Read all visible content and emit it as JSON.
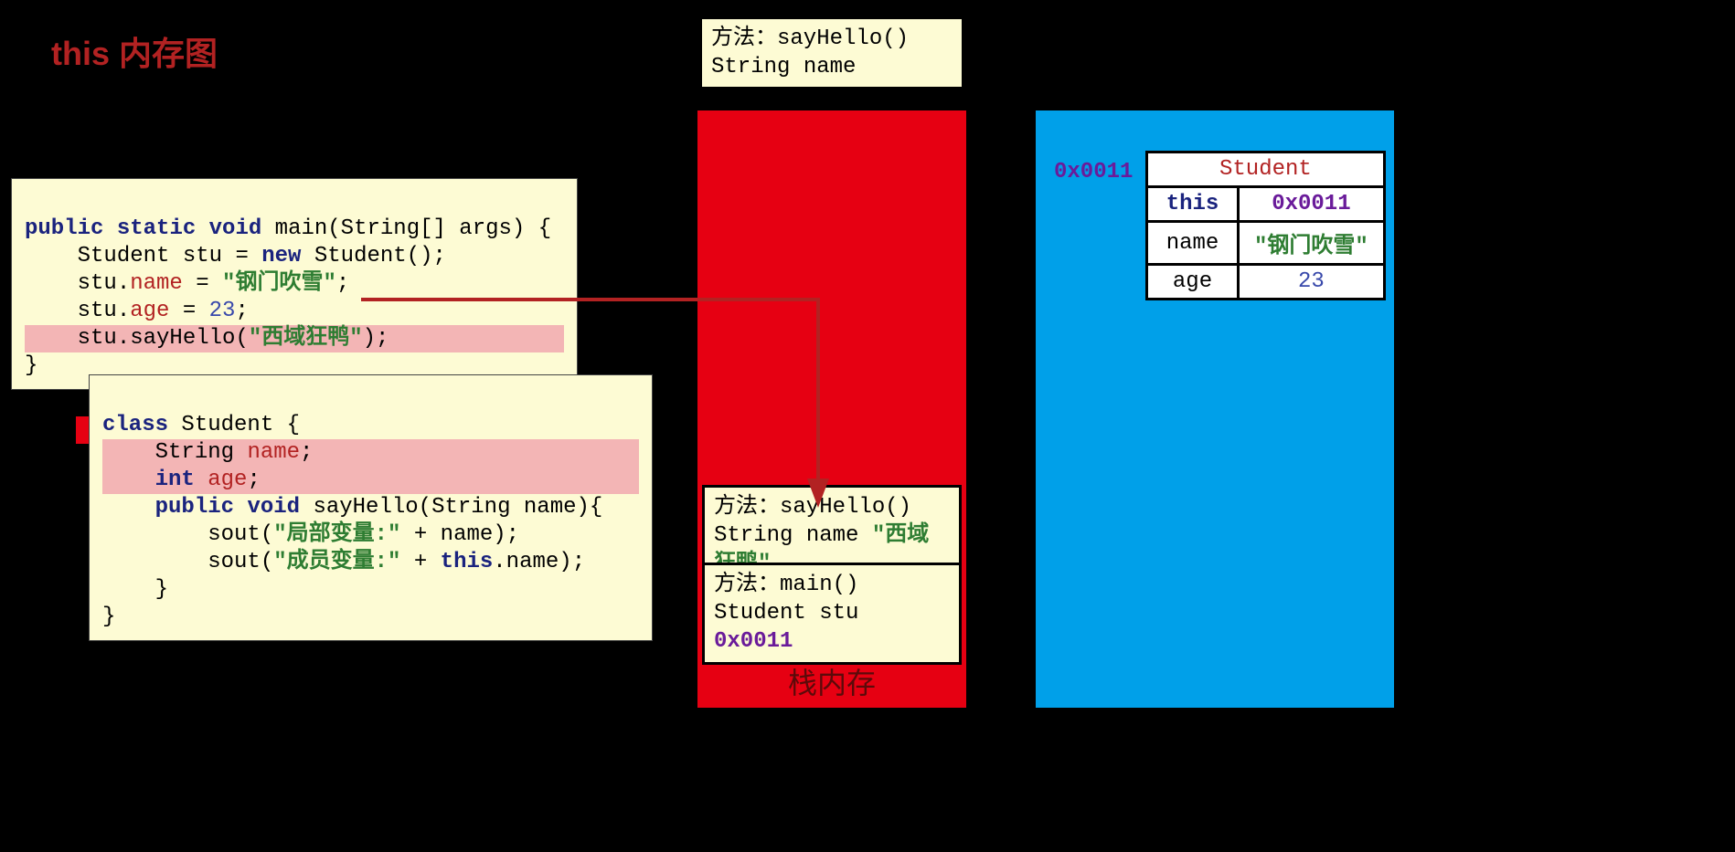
{
  "title": "this 内存图",
  "code_main": {
    "line1_a": "public",
    "line1_b": "static",
    "line1_c": "void",
    "line1_d": " main(String[] args) {",
    "line2_a": "    Student stu = ",
    "line2_b": "new",
    "line2_c": " Student();",
    "line3_a": "    stu.",
    "line3_b": "name",
    "line3_c": " = ",
    "line3_d": "\"钢门吹雪\"",
    "line3_e": ";",
    "line4_a": "    stu.",
    "line4_b": "age",
    "line4_c": " = ",
    "line4_d": "23",
    "line4_e": ";",
    "line5_a": "    stu.sayHello(",
    "line5_b": "\"西域狂鸭\"",
    "line5_c": ");",
    "line6": "}"
  },
  "code_class": {
    "line1_a": "class",
    "line1_b": " Student {",
    "line2_a": "    String ",
    "line2_b": "name",
    "line2_c": ";",
    "line3_a": "    ",
    "line3_b": "int",
    "line3_c": " ",
    "line3_d": "age",
    "line3_e": ";",
    "line4_a": "    ",
    "line4_b": "public",
    "line4_c": " ",
    "line4_d": "void",
    "line4_e": " sayHello(String name){",
    "line5_a": "        sout(",
    "line5_b": "\"局部变量:\"",
    "line5_c": " + name);",
    "line6_a": "        sout(",
    "line6_b": "\"成员变量:\"",
    "line6_c": " + ",
    "line6_d": "this",
    "line6_e": ".name);",
    "line7": "    }",
    "line8": "}"
  },
  "overflow_frame": {
    "line1_a": "方法：",
    "line1_b": "sayHello()",
    "line2": "String name"
  },
  "stack": {
    "label": "栈内存",
    "frame_sayhello": {
      "line1_a": "方法：",
      "line1_b": "sayHello()",
      "line2_a": "String name ",
      "line2_b": "\"西域狂鸭\""
    },
    "frame_main": {
      "line1_a": "方法：",
      "line1_b": "main()",
      "line2_a": "Student stu  ",
      "line2_b": "0x0011"
    }
  },
  "heap": {
    "addr": "0x0011",
    "object": {
      "class": "Student",
      "rows": [
        {
          "k": "this",
          "v": "0x0011",
          "kcls": "this",
          "vcls": "addr"
        },
        {
          "k": "name",
          "v": "\"钢门吹雪\"",
          "kcls": "key",
          "vcls": "str"
        },
        {
          "k": "age",
          "v": "23",
          "kcls": "key",
          "vcls": "num"
        }
      ]
    }
  }
}
